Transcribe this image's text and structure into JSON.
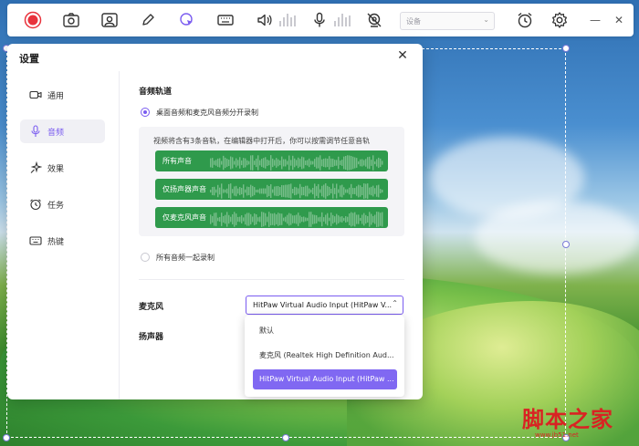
{
  "toolbar": {
    "record_button": "record",
    "screenshot_button": "screenshot",
    "webcam_button": "webcam",
    "pen_button": "pen",
    "cursor_button": "cursor",
    "keyboard_button": "keyboard",
    "speaker_button": "speaker",
    "mic_button": "microphone",
    "camera_off_button": "camera-off",
    "device_select_value": "设备",
    "timer_button": "timer",
    "settings_button": "settings",
    "minimize_label": "—",
    "close_label": "✕"
  },
  "dialog": {
    "title": "设置",
    "close_label": "✕",
    "nav": [
      {
        "label": "通用",
        "icon": "video-icon",
        "active": false
      },
      {
        "label": "音频",
        "icon": "microphone-icon",
        "active": true
      },
      {
        "label": "效果",
        "icon": "sparkle-icon",
        "active": false
      },
      {
        "label": "任务",
        "icon": "alarm-icon",
        "active": false
      },
      {
        "label": "热键",
        "icon": "keyboard-icon",
        "active": false
      }
    ],
    "audio_tracks": {
      "section_title": "音频轨道",
      "option_separate": "桌面音频和麦克风音频分开录制",
      "tracks_description": "视频将含有3条音轨，在编辑器中打开后，你可以按需调节任意音轨",
      "tracks": [
        {
          "label": "所有声音"
        },
        {
          "label": "仅扬声器声音"
        },
        {
          "label": "仅麦克风声音"
        }
      ],
      "option_together": "所有音频一起录制",
      "selected_option": "option_separate"
    },
    "microphone": {
      "label": "麦克风",
      "selected": "HitPaw Virtual Audio Input (HitPaw V...",
      "options": [
        {
          "label": "默认",
          "selected": false
        },
        {
          "label": "麦克风 (Realtek High Definition Aud...",
          "selected": false
        },
        {
          "label": "HitPaw Virtual Audio Input (HitPaw ...",
          "selected": true
        }
      ]
    },
    "speaker": {
      "label": "扬声器"
    }
  },
  "colors": {
    "accent": "#7a5cf0",
    "record_red": "#e8323c",
    "track_green": "#2f9a4c"
  },
  "watermark": {
    "main": "脚本之家",
    "sub": "www.jb51.net"
  }
}
